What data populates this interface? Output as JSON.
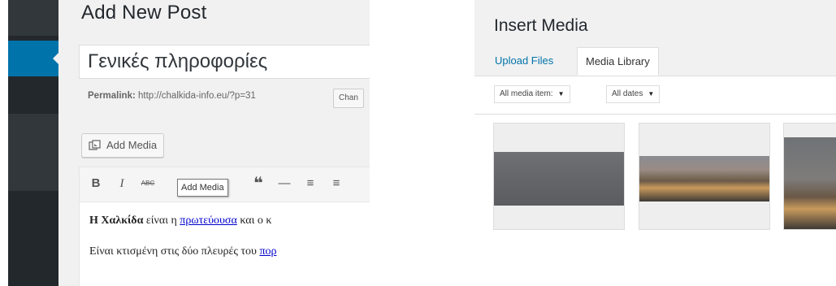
{
  "editor": {
    "page_title": "Add New Post",
    "post_title": "Γενικές πληροφορίες",
    "permalink_label": "Permalink:",
    "permalink_url": "http://chalkida-info.eu/?p=31",
    "change_label": "Chan",
    "add_media_label": "Add Media",
    "tooltip": "Add Media",
    "toolbar": [
      "B",
      "I",
      "ABC",
      "❝",
      "—",
      "≡",
      "≡"
    ],
    "content": {
      "p1_bold": "Η Χαλκίδα",
      "p1_text": " είναι η ",
      "p1_link": "πρωτεύουσα",
      "p1_tail": " και ο κ",
      "p2_text": "Είναι κτισμένη στις δύο πλευρές του ",
      "p2_link": "πορ"
    }
  },
  "media": {
    "title": "Insert Media",
    "tabs": [
      "Upload Files",
      "Media Library"
    ],
    "active_tab": "Media Library",
    "filter_type": "All media item:",
    "filter_date": "All dates"
  },
  "colors": {
    "accent": "#0073aa",
    "sidebar": "#23282d",
    "panel": "#f1f1f1"
  }
}
